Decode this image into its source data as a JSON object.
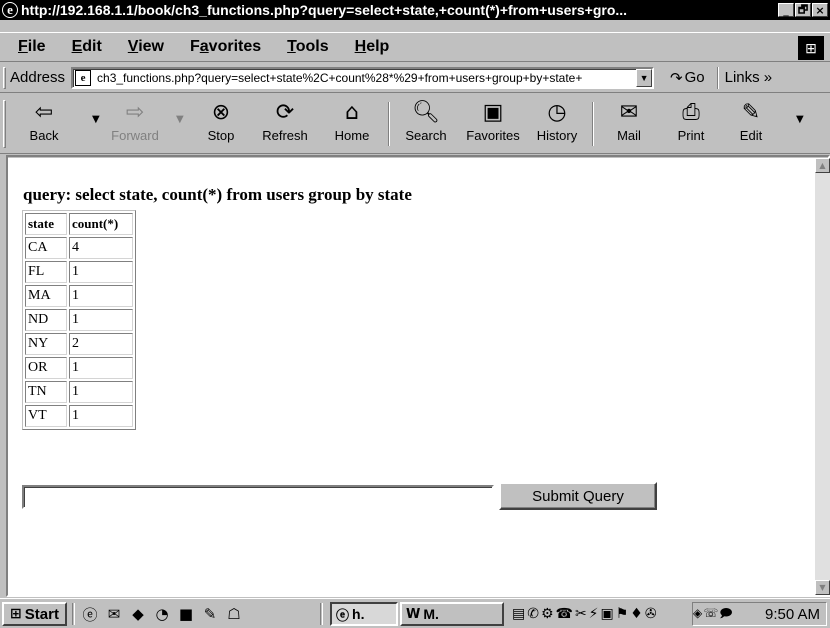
{
  "window": {
    "title": "http://192.168.1.1/book/ch3_functions.php?query=select+state,+count(*)+from+users+gro...",
    "minimize": "_",
    "maximize": "🗗",
    "close": "×"
  },
  "menu": {
    "items": [
      {
        "name": "file",
        "label": "File"
      },
      {
        "name": "edit",
        "label": "Edit"
      },
      {
        "name": "view",
        "label": "View"
      },
      {
        "name": "favorites",
        "label": "Favorites"
      },
      {
        "name": "tools",
        "label": "Tools"
      },
      {
        "name": "help",
        "label": "Help"
      }
    ]
  },
  "address": {
    "label": "Address",
    "url": "ch3_functions.php?query=select+state%2C+count%28*%29+from+users+group+by+state+",
    "go_label": "Go",
    "links_label": "Links »"
  },
  "toolbar": {
    "back": "Back",
    "forward": "Forward",
    "stop": "Stop",
    "refresh": "Refresh",
    "home": "Home",
    "search": "Search",
    "favorites": "Favorites",
    "history": "History",
    "mail": "Mail",
    "print": "Print",
    "edit": "Edit"
  },
  "page": {
    "heading": "query: select state, count(*) from users group by state",
    "table": {
      "headers": [
        "state",
        "count(*)"
      ],
      "rows": [
        [
          "CA",
          "4"
        ],
        [
          "FL",
          "1"
        ],
        [
          "MA",
          "1"
        ],
        [
          "ND",
          "1"
        ],
        [
          "NY",
          "2"
        ],
        [
          "OR",
          "1"
        ],
        [
          "TN",
          "1"
        ],
        [
          "VT",
          "1"
        ]
      ]
    },
    "query_input_value": "",
    "submit_label": "Submit Query"
  },
  "taskbar": {
    "start_label": "Start",
    "tasks": [
      {
        "label": "h.",
        "active": true
      },
      {
        "label": "M.",
        "active": false
      }
    ],
    "clock": "9:50 AM"
  },
  "colors": {
    "chrome": "#c0c0c0",
    "titlebar": "#000000",
    "content_bg": "#ffffff"
  }
}
